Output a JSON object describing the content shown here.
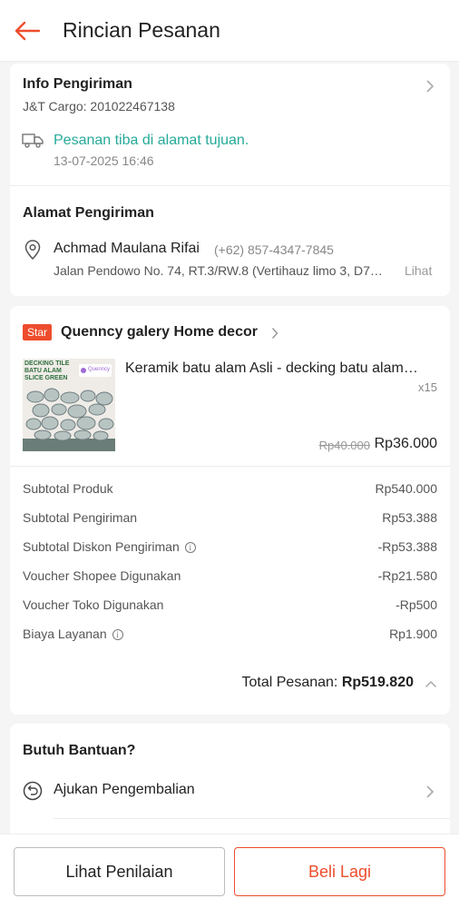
{
  "header": {
    "title": "Rincian Pesanan"
  },
  "shipping_info": {
    "title": "Info Pengiriman",
    "courier": "J&T Cargo: 201022467138",
    "status": "Pesanan tiba di alamat tujuan.",
    "timestamp": "13-07-2025 16:46"
  },
  "address": {
    "title": "Alamat Pengiriman",
    "name": "Achmad Maulana Rifai",
    "phone": "(+62) 857-4347-7845",
    "street": "Jalan Pendowo No. 74, RT.3/RW.8 (Vertihauz limo 3, D7…",
    "view_label": "Lihat"
  },
  "shop": {
    "badge": "Star",
    "name": "Quenncy galery Home decor"
  },
  "product": {
    "name": "Keramik batu alam Asli - decking batu alam…",
    "quantity": "x15",
    "original_price": "Rp40.000",
    "price": "Rp36.000",
    "thumb_line1": "DECKING TILE",
    "thumb_line2": "BATU ALAM",
    "thumb_line3": "SLICE GREEN",
    "thumb_brand": "Quenncy"
  },
  "summary": {
    "rows": [
      {
        "label": "Subtotal Produk",
        "value": "Rp540.000"
      },
      {
        "label": "Subtotal Pengiriman",
        "value": "Rp53.388"
      },
      {
        "label": "Subtotal Diskon Pengiriman",
        "value": "-Rp53.388"
      },
      {
        "label": "Voucher Shopee Digunakan",
        "value": "-Rp21.580"
      },
      {
        "label": "Voucher Toko Digunakan",
        "value": "-Rp500"
      },
      {
        "label": "Biaya Layanan",
        "value": "Rp1.900"
      }
    ],
    "total_label": "Total Pesanan:",
    "total_value": "Rp519.820"
  },
  "help": {
    "title": "Butuh Bantuan?",
    "return_label": "Ajukan Pengembalian"
  },
  "buttons": {
    "left": "Lihat Penilaian",
    "right": "Beli Lagi"
  },
  "colors": {
    "accent": "#ee4d2d",
    "status_green": "#26aa99"
  }
}
